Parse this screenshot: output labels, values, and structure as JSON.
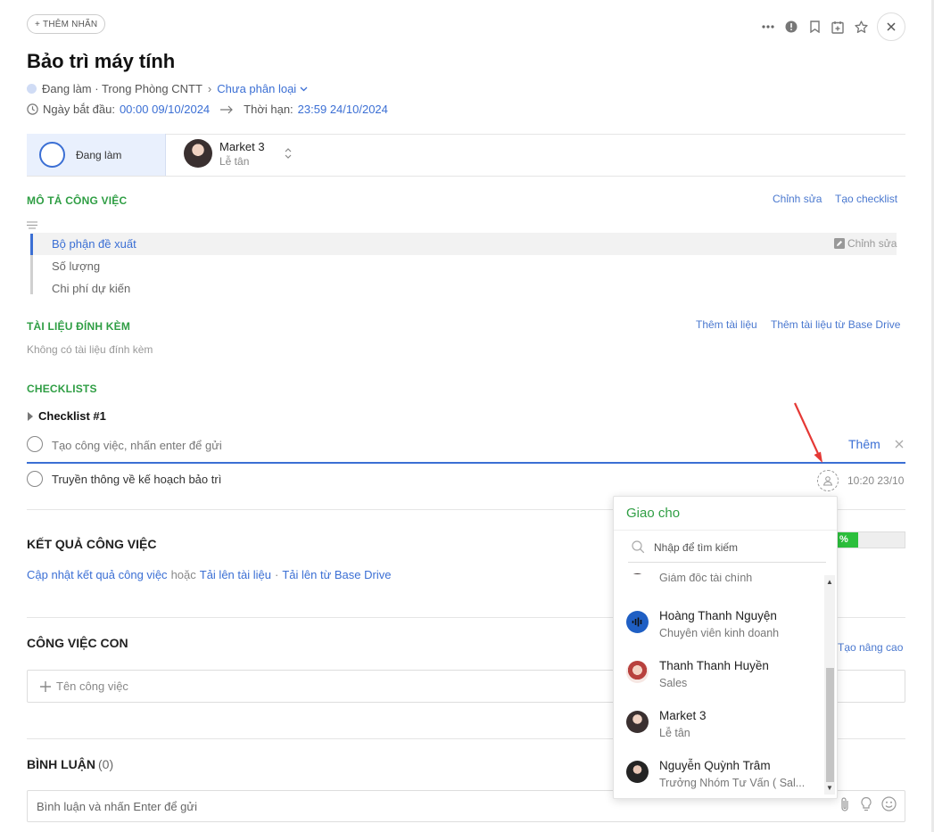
{
  "header": {
    "add_tag_label": "THÊM NHÃN",
    "title": "Bảo trì máy tính",
    "status": "Đang làm · Trong Phòng CNTT",
    "category": "Chưa phân loại",
    "start_label": "Ngày bắt đầu:",
    "start_value": "00:00 09/10/2024",
    "due_label": "Thời hạn:",
    "due_value": "23:59 24/10/2024"
  },
  "state": {
    "label": "Đang làm"
  },
  "assignee": {
    "name": "Market 3",
    "role": "Lễ tân"
  },
  "description": {
    "title": "MÔ TẢ CÔNG VIỆC",
    "edit_label": "Chỉnh sửa",
    "create_checklist_label": "Tạo checklist",
    "items": [
      "Bộ phận đề xuất",
      "Số lượng",
      "Chi phí dự kiến"
    ],
    "item_edit_label": "Chỉnh sửa"
  },
  "attachments": {
    "title": "TÀI LIỆU ĐÍNH KÈM",
    "add_label": "Thêm tài liệu",
    "add_drive_label": "Thêm tài liệu từ Base Drive",
    "empty_text": "Không có tài liệu đính kèm"
  },
  "checklists": {
    "title": "CHECKLISTS",
    "name": "Checklist #1",
    "input_placeholder": "Tạo công việc, nhấn enter để gửi",
    "add_label": "Thêm",
    "items": [
      {
        "text": "Truyền thông về kế hoạch bảo trì",
        "time": "10:20 23/10"
      }
    ]
  },
  "results": {
    "title": "KẾT QUẢ CÔNG VIỆC",
    "update_label": "Cập nhật kết quả công việc",
    "or_text": "hoặc",
    "upload_label": "Tải lên tài liệu",
    "sep": "·",
    "upload_drive_label": "Tải lên từ Base Drive",
    "progress_text": "%",
    "progress_fraction": 0.45
  },
  "subtasks": {
    "title": "CÔNG VIỆC CON",
    "advanced_label": "Tạo nâng cao",
    "input_placeholder": "Tên công việc"
  },
  "comments": {
    "title": "BÌNH LUẬN",
    "count": "(0)",
    "input_placeholder": "Bình luận và nhấn Enter để gửi"
  },
  "assign_popup": {
    "title": "Giao cho",
    "search_placeholder": "Nhập để tìm kiếm",
    "people": [
      {
        "name": "",
        "role": "Giám đốc tài chính"
      },
      {
        "name": "Hoàng Thanh Nguyện",
        "role": "Chuyên viên kinh doanh"
      },
      {
        "name": "Thanh Thanh Huyền",
        "role": "Sales"
      },
      {
        "name": "Market 3",
        "role": "Lễ tân"
      },
      {
        "name": "Nguyễn Quỳnh Trâm",
        "role": "Trưởng Nhóm Tư Vấn ( Sal..."
      }
    ]
  },
  "colors": {
    "accent": "#3b6fd4",
    "green": "#2f9e44",
    "annotation_arrow": "#e53935"
  }
}
